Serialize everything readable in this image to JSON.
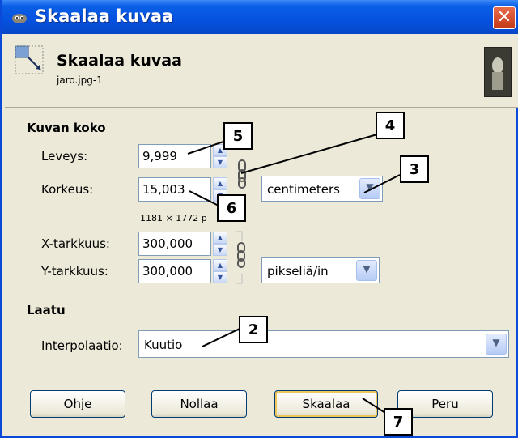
{
  "window": {
    "title": "Skaalaa kuvaa",
    "close_symbol": "✕"
  },
  "header": {
    "title": "Skaalaa kuvaa",
    "subtitle": "jaro.jpg-1"
  },
  "image_size": {
    "section_label": "Kuvan koko",
    "width_label": "Leveys:",
    "width_value": "9,999",
    "height_label": "Korkeus:",
    "height_value": "15,003",
    "unit": "centimeters",
    "pixel_size": "1181 × 1772 p",
    "xres_label": "X-tarkkuus:",
    "xres_value": "300,000",
    "yres_label": "Y-tarkkuus:",
    "yres_value": "300,000",
    "res_unit": "pikseliä/in"
  },
  "quality": {
    "section_label": "Laatu",
    "interp_label": "Interpolaatio:",
    "interp_value": "Kuutio"
  },
  "buttons": {
    "help": "Ohje",
    "reset": "Nollaa",
    "scale": "Skaalaa",
    "cancel": "Peru"
  },
  "callouts": [
    "2",
    "3",
    "4",
    "5",
    "6",
    "7"
  ],
  "colors": {
    "titlebar": "#0551e0",
    "close": "#c33a17",
    "face": "#ece9d8"
  }
}
